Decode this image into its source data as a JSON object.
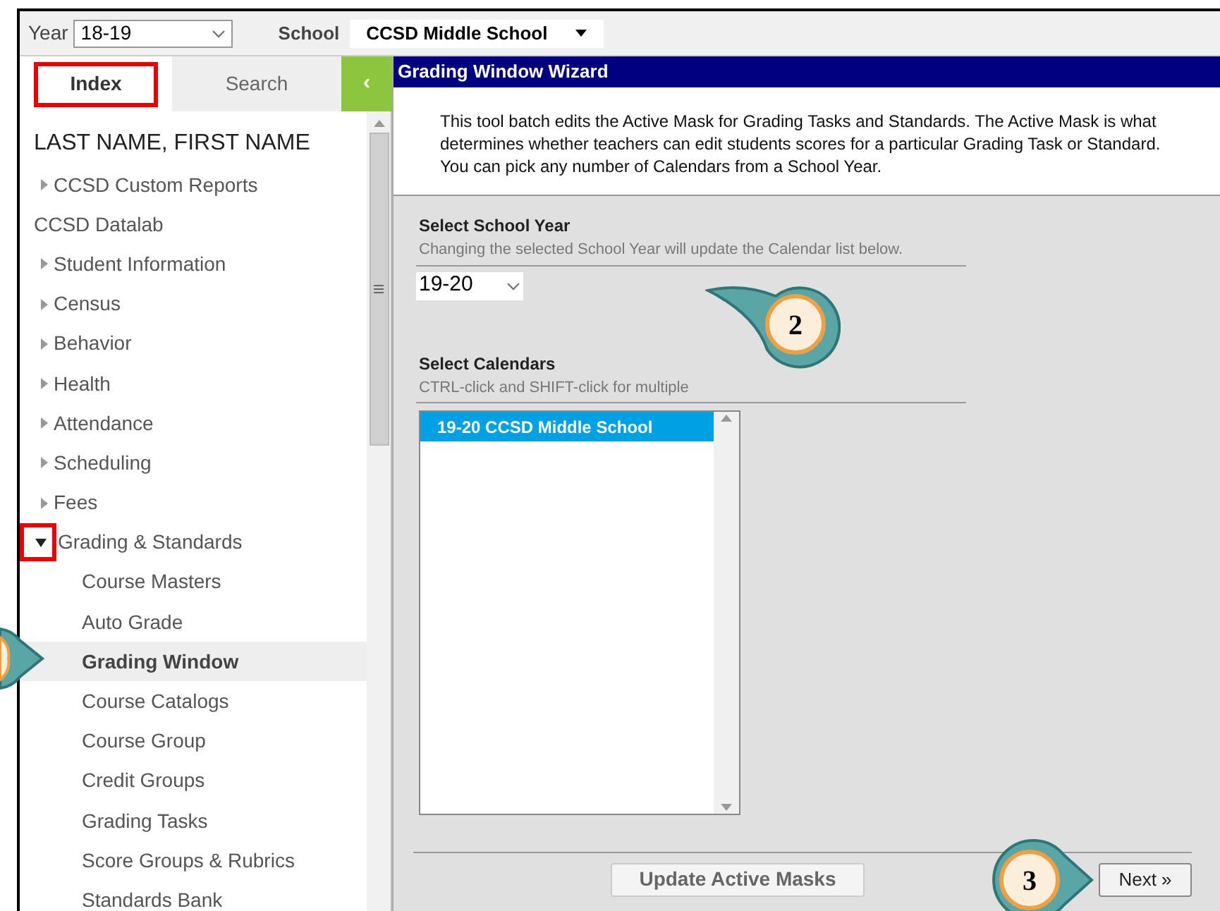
{
  "top_bar": {
    "year_label": "Year",
    "year_value": "18-19",
    "school_label": "School",
    "school_value": "CCSD Middle School"
  },
  "sidebar": {
    "tabs": [
      {
        "label": "Index",
        "selected": true,
        "highlighted": true
      },
      {
        "label": "Search",
        "selected": false,
        "highlighted": false
      }
    ],
    "collapse_button": "‹",
    "user_name": "LAST NAME, FIRST NAME",
    "items": [
      {
        "label": "CCSD Custom Reports",
        "kind": "folder",
        "expanded": false,
        "highlighted": false
      },
      {
        "label": "CCSD Datalab",
        "kind": "link"
      },
      {
        "label": "Student Information",
        "kind": "folder",
        "expanded": false,
        "highlighted": false
      },
      {
        "label": "Census",
        "kind": "folder",
        "expanded": false,
        "highlighted": false
      },
      {
        "label": "Behavior",
        "kind": "folder",
        "expanded": false,
        "highlighted": false
      },
      {
        "label": "Health",
        "kind": "folder",
        "expanded": false,
        "highlighted": false
      },
      {
        "label": "Attendance",
        "kind": "folder",
        "expanded": false,
        "highlighted": false
      },
      {
        "label": "Scheduling",
        "kind": "folder",
        "expanded": false,
        "highlighted": false
      },
      {
        "label": "Fees",
        "kind": "folder",
        "expanded": false,
        "highlighted": false
      },
      {
        "label": "Grading & Standards",
        "kind": "folder",
        "expanded": true,
        "highlighted": true,
        "children": [
          {
            "label": "Course Masters",
            "selected": false
          },
          {
            "label": "Auto Grade",
            "selected": false
          },
          {
            "label": "Grading Window",
            "selected": true
          },
          {
            "label": "Course Catalogs",
            "selected": false
          },
          {
            "label": "Course Group",
            "selected": false
          },
          {
            "label": "Credit Groups",
            "selected": false
          },
          {
            "label": "Grading Tasks",
            "selected": false
          },
          {
            "label": "Score Groups & Rubrics",
            "selected": false
          },
          {
            "label": "Standards Bank",
            "selected": false
          }
        ]
      }
    ]
  },
  "wizard": {
    "title": "Grading Window Wizard",
    "description": "This tool batch edits the Active Mask for Grading Tasks and Standards. The Active Mask is what determines whether teachers can edit students scores for a particular Grading Task or Standard. You can pick any number of Calendars from a School Year.",
    "school_year": {
      "heading": "Select School Year",
      "hint": "Changing the selected School Year will update the Calendar list below.",
      "value": "19-20"
    },
    "calendars": {
      "heading": "Select Calendars",
      "hint": "CTRL-click and SHIFT-click for multiple",
      "options": [
        {
          "label": "19-20 CCSD Middle School",
          "selected": true
        }
      ]
    },
    "buttons": [
      {
        "label": "Update Active Masks",
        "kind": "secondary"
      },
      {
        "label": "Next »",
        "kind": "primary"
      }
    ]
  },
  "callouts": [
    {
      "number": "2"
    },
    {
      "number": "3"
    }
  ]
}
